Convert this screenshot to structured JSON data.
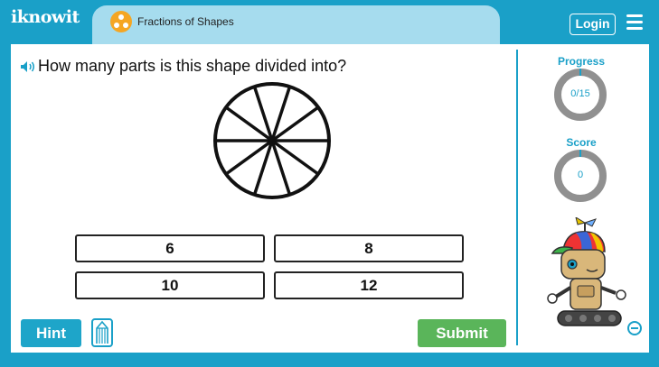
{
  "app": {
    "logo_text": "iknowit"
  },
  "topic": {
    "title": "Fractions of Shapes",
    "icon": "fractions-icon"
  },
  "header": {
    "login_label": "Login",
    "menu_icon": "hamburger-icon"
  },
  "question": {
    "text": "How many parts is this shape divided into?",
    "icon": "speaker-icon",
    "shape_parts": 10
  },
  "answers": [
    {
      "label": "6"
    },
    {
      "label": "8"
    },
    {
      "label": "10"
    },
    {
      "label": "12"
    }
  ],
  "controls": {
    "hint_label": "Hint",
    "submit_label": "Submit",
    "pencil_icon": "pencil-icon"
  },
  "sidebar": {
    "progress": {
      "label": "Progress",
      "value": "0/15"
    },
    "score": {
      "label": "Score",
      "value": "0"
    },
    "expand_icon": "expand-icon"
  },
  "colors": {
    "brand": "#1aa0c8",
    "tab": "#a6dcee",
    "submit": "#5ab55a",
    "ring": "#909090"
  }
}
